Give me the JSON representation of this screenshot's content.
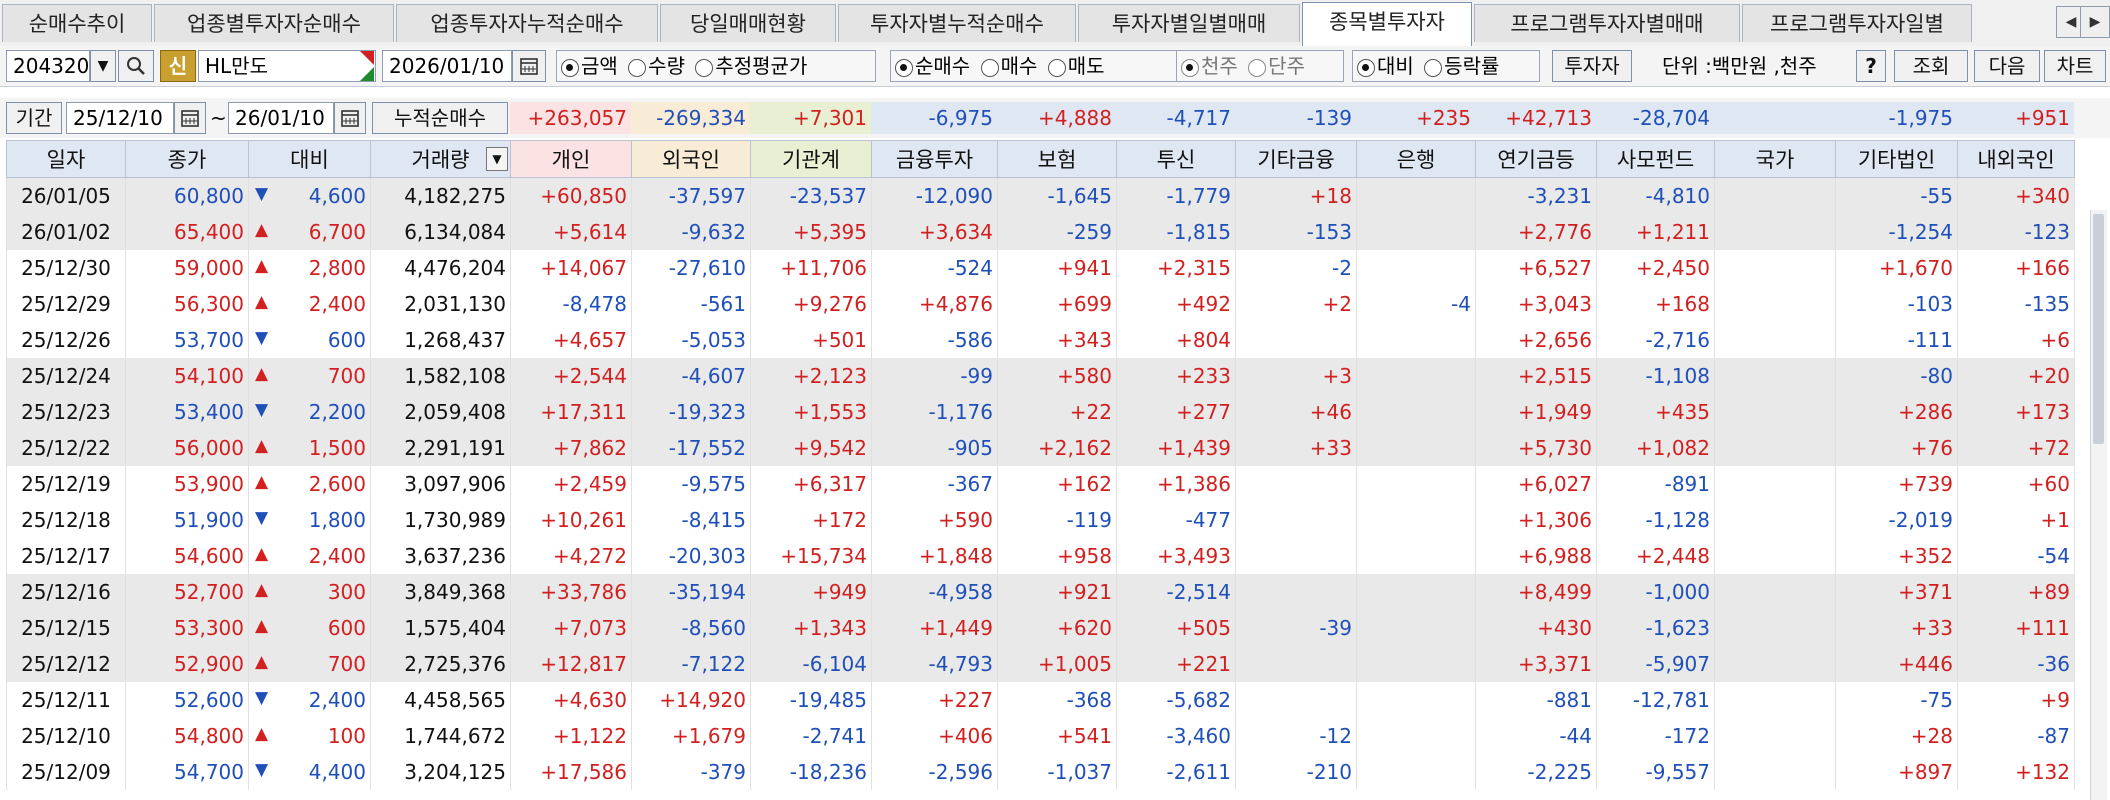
{
  "tabs": [
    {
      "label": "순매수추이",
      "active": false
    },
    {
      "label": "업종별투자자순매수",
      "active": false
    },
    {
      "label": "업종투자자누적순매수",
      "active": false
    },
    {
      "label": "당일매매현황",
      "active": false
    },
    {
      "label": "투자자별누적순매수",
      "active": false
    },
    {
      "label": "투자자별일별매매",
      "active": false
    },
    {
      "label": "종목별투자자",
      "active": true
    },
    {
      "label": "프로그램투자자별매매",
      "active": false
    },
    {
      "label": "프로그램투자자일별",
      "active": false
    }
  ],
  "nav": {
    "prev": "◀",
    "next": "▶"
  },
  "toolbar": {
    "code": "204320",
    "new_badge": "신",
    "stock_name": "HL만도",
    "date": "2026/01/10",
    "unit_radios": [
      {
        "label": "금액",
        "on": true
      },
      {
        "label": "수량",
        "on": false
      },
      {
        "label": "추정평균가",
        "on": false
      }
    ],
    "trade_radios": [
      {
        "label": "순매수",
        "on": true
      },
      {
        "label": "매수",
        "on": false
      },
      {
        "label": "매도",
        "on": false
      }
    ],
    "share_radios": [
      {
        "label": "천주",
        "on": true
      },
      {
        "label": "단주",
        "on": false
      }
    ],
    "compare_radios": [
      {
        "label": "대비",
        "on": true
      },
      {
        "label": "등락률",
        "on": false
      }
    ],
    "investor_btn": "투자자",
    "unit_text": "단위 :백만원 ,천주",
    "help_btn": "?",
    "query_btn": "조회",
    "next_btn": "다음",
    "chart_btn": "차트"
  },
  "filter": {
    "period_label": "기간",
    "from": "25/12/10",
    "tilde": "~",
    "to": "26/01/10",
    "cum_label": "누적순매수",
    "sums": [
      "+263,057",
      "-269,334",
      "+7,301",
      "-6,975",
      "+4,888",
      "-4,717",
      "-139",
      "+235",
      "+42,713",
      "-28,704",
      "",
      "-1,975",
      "+951"
    ]
  },
  "headers": [
    "일자",
    "종가",
    "대비",
    "거래량",
    "개인",
    "외국인",
    "기관계",
    "금융투자",
    "보험",
    "투신",
    "기타금융",
    "은행",
    "연기금등",
    "사모펀드",
    "국가",
    "기타법인",
    "내외국인"
  ],
  "rows": [
    {
      "date": "26/01/05",
      "close": "60,800",
      "dir": "down",
      "chg": "4,600",
      "vol": "4,182,275",
      "v": [
        "+60,850",
        "-37,597",
        "-23,537",
        "-12,090",
        "-1,645",
        "-1,779",
        "+18",
        "",
        "-3,231",
        "-4,810",
        "",
        "-55",
        "+340"
      ],
      "shade": true
    },
    {
      "date": "26/01/02",
      "close": "65,400",
      "dir": "up",
      "chg": "6,700",
      "vol": "6,134,084",
      "v": [
        "+5,614",
        "-9,632",
        "+5,395",
        "+3,634",
        "-259",
        "-1,815",
        "-153",
        "",
        "+2,776",
        "+1,211",
        "",
        "-1,254",
        "-123"
      ],
      "shade": true
    },
    {
      "date": "25/12/30",
      "close": "59,000",
      "dir": "up",
      "chg": "2,800",
      "vol": "4,476,204",
      "v": [
        "+14,067",
        "-27,610",
        "+11,706",
        "-524",
        "+941",
        "+2,315",
        "-2",
        "",
        "+6,527",
        "+2,450",
        "",
        "+1,670",
        "+166"
      ],
      "shade": false
    },
    {
      "date": "25/12/29",
      "close": "56,300",
      "dir": "up",
      "chg": "2,400",
      "vol": "2,031,130",
      "v": [
        "-8,478",
        "-561",
        "+9,276",
        "+4,876",
        "+699",
        "+492",
        "+2",
        "-4",
        "+3,043",
        "+168",
        "",
        "-103",
        "-135"
      ],
      "shade": false
    },
    {
      "date": "25/12/26",
      "close": "53,700",
      "dir": "down",
      "chg": "600",
      "vol": "1,268,437",
      "v": [
        "+4,657",
        "-5,053",
        "+501",
        "-586",
        "+343",
        "+804",
        "",
        "",
        "+2,656",
        "-2,716",
        "",
        "-111",
        "+6"
      ],
      "shade": false
    },
    {
      "date": "25/12/24",
      "close": "54,100",
      "dir": "up",
      "chg": "700",
      "vol": "1,582,108",
      "v": [
        "+2,544",
        "-4,607",
        "+2,123",
        "-99",
        "+580",
        "+233",
        "+3",
        "",
        "+2,515",
        "-1,108",
        "",
        "-80",
        "+20"
      ],
      "shade": true
    },
    {
      "date": "25/12/23",
      "close": "53,400",
      "dir": "down",
      "chg": "2,200",
      "vol": "2,059,408",
      "v": [
        "+17,311",
        "-19,323",
        "+1,553",
        "-1,176",
        "+22",
        "+277",
        "+46",
        "",
        "+1,949",
        "+435",
        "",
        "+286",
        "+173"
      ],
      "shade": true
    },
    {
      "date": "25/12/22",
      "close": "56,000",
      "dir": "up",
      "chg": "1,500",
      "vol": "2,291,191",
      "v": [
        "+7,862",
        "-17,552",
        "+9,542",
        "-905",
        "+2,162",
        "+1,439",
        "+33",
        "",
        "+5,730",
        "+1,082",
        "",
        "+76",
        "+72"
      ],
      "shade": true
    },
    {
      "date": "25/12/19",
      "close": "53,900",
      "dir": "up",
      "chg": "2,600",
      "vol": "3,097,906",
      "v": [
        "+2,459",
        "-9,575",
        "+6,317",
        "-367",
        "+162",
        "+1,386",
        "",
        "",
        "+6,027",
        "-891",
        "",
        "+739",
        "+60"
      ],
      "shade": false
    },
    {
      "date": "25/12/18",
      "close": "51,900",
      "dir": "down",
      "chg": "1,800",
      "vol": "1,730,989",
      "v": [
        "+10,261",
        "-8,415",
        "+172",
        "+590",
        "-119",
        "-477",
        "",
        "",
        "+1,306",
        "-1,128",
        "",
        "-2,019",
        "+1"
      ],
      "shade": false
    },
    {
      "date": "25/12/17",
      "close": "54,600",
      "dir": "up",
      "chg": "2,400",
      "vol": "3,637,236",
      "v": [
        "+4,272",
        "-20,303",
        "+15,734",
        "+1,848",
        "+958",
        "+3,493",
        "",
        "",
        "+6,988",
        "+2,448",
        "",
        "+352",
        "-54"
      ],
      "shade": false
    },
    {
      "date": "25/12/16",
      "close": "52,700",
      "dir": "up",
      "chg": "300",
      "vol": "3,849,368",
      "v": [
        "+33,786",
        "-35,194",
        "+949",
        "-4,958",
        "+921",
        "-2,514",
        "",
        "",
        "+8,499",
        "-1,000",
        "",
        "+371",
        "+89"
      ],
      "shade": true
    },
    {
      "date": "25/12/15",
      "close": "53,300",
      "dir": "up",
      "chg": "600",
      "vol": "1,575,404",
      "v": [
        "+7,073",
        "-8,560",
        "+1,343",
        "+1,449",
        "+620",
        "+505",
        "-39",
        "",
        "+430",
        "-1,623",
        "",
        "+33",
        "+111"
      ],
      "shade": true
    },
    {
      "date": "25/12/12",
      "close": "52,900",
      "dir": "up",
      "chg": "700",
      "vol": "2,725,376",
      "v": [
        "+12,817",
        "-7,122",
        "-6,104",
        "-4,793",
        "+1,005",
        "+221",
        "",
        "",
        "+3,371",
        "-5,907",
        "",
        "+446",
        "-36"
      ],
      "shade": true
    },
    {
      "date": "25/12/11",
      "close": "52,600",
      "dir": "down",
      "chg": "2,400",
      "vol": "4,458,565",
      "v": [
        "+4,630",
        "+14,920",
        "-19,485",
        "+227",
        "-368",
        "-5,682",
        "",
        "",
        "-881",
        "-12,781",
        "",
        "-75",
        "+9"
      ],
      "shade": false
    },
    {
      "date": "25/12/10",
      "close": "54,800",
      "dir": "up",
      "chg": "100",
      "vol": "1,744,672",
      "v": [
        "+1,122",
        "+1,679",
        "-2,741",
        "+406",
        "+541",
        "-3,460",
        "-12",
        "",
        "-44",
        "-172",
        "",
        "+28",
        "-87"
      ],
      "shade": false
    },
    {
      "date": "25/12/09",
      "close": "54,700",
      "dir": "down",
      "chg": "4,400",
      "vol": "3,204,125",
      "v": [
        "+17,586",
        "-379",
        "-18,236",
        "-2,596",
        "-1,037",
        "-2,611",
        "-210",
        "",
        "-2,225",
        "-9,557",
        "",
        "+897",
        "+132"
      ],
      "shade": false
    }
  ],
  "colors": {
    "up": "#d21f1f",
    "down": "#1f4fb8"
  }
}
